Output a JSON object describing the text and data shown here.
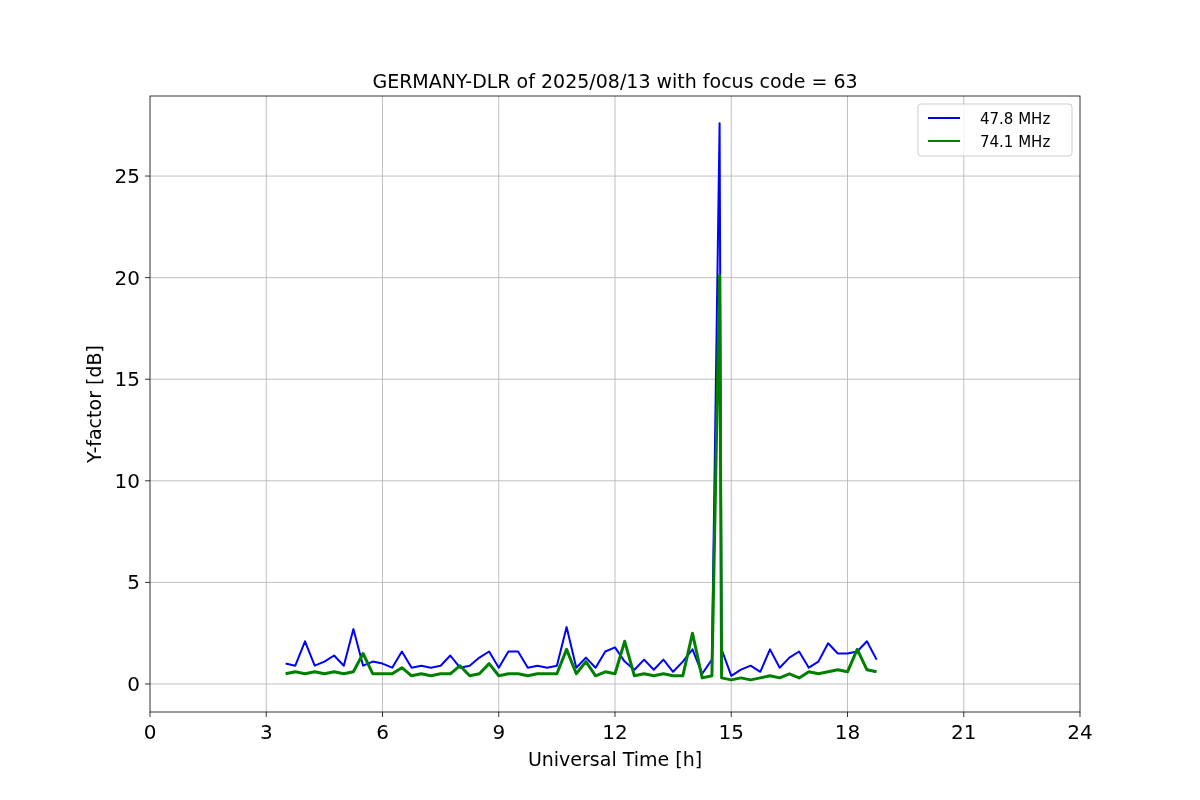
{
  "figure": {
    "chart_data": {
      "type": "line",
      "title": "GERMANY-DLR of 2025/08/13 with focus code = 63",
      "xlabel": "Universal Time [h]",
      "ylabel": "Y-factor [dB]",
      "x": [
        3.5,
        3.75,
        4,
        4.25,
        4.5,
        4.75,
        5,
        5.25,
        5.5,
        5.75,
        6,
        6.25,
        6.5,
        6.75,
        7,
        7.25,
        7.5,
        7.75,
        8,
        8.25,
        8.5,
        8.75,
        9,
        9.25,
        9.5,
        9.75,
        10,
        10.25,
        10.5,
        10.75,
        11,
        11.25,
        11.5,
        11.75,
        12,
        12.25,
        12.5,
        12.75,
        13,
        13.25,
        13.5,
        13.75,
        14,
        14.25,
        14.5,
        14.7,
        14.75,
        15,
        15.25,
        15.5,
        15.75,
        16,
        16.25,
        16.5,
        16.75,
        17,
        17.25,
        17.5,
        17.75,
        18,
        18.25,
        18.5,
        18.75
      ],
      "series": [
        {
          "name": "47.8 MHz",
          "color": "#0000ff",
          "values": [
            1.0,
            0.9,
            2.1,
            0.9,
            1.1,
            1.4,
            0.9,
            2.7,
            0.9,
            1.1,
            1.0,
            0.8,
            1.6,
            0.8,
            0.9,
            0.8,
            0.9,
            1.4,
            0.8,
            0.9,
            1.3,
            1.6,
            0.8,
            1.6,
            1.6,
            0.8,
            0.9,
            0.8,
            0.9,
            2.8,
            0.8,
            1.3,
            0.8,
            1.6,
            1.8,
            1.1,
            0.7,
            1.2,
            0.7,
            1.2,
            0.6,
            1.1,
            1.7,
            0.5,
            1.2,
            27.6,
            1.7,
            0.4,
            0.7,
            0.9,
            0.6,
            1.7,
            0.8,
            1.3,
            1.6,
            0.8,
            1.1,
            2.0,
            1.5,
            1.5,
            1.6,
            2.1,
            1.2
          ]
        },
        {
          "name": "74.1 MHz",
          "color": "#008000",
          "values": [
            0.5,
            0.6,
            0.5,
            0.6,
            0.5,
            0.6,
            0.5,
            0.6,
            1.5,
            0.5,
            0.5,
            0.5,
            0.8,
            0.4,
            0.5,
            0.4,
            0.5,
            0.5,
            0.9,
            0.4,
            0.5,
            1.0,
            0.4,
            0.5,
            0.5,
            0.4,
            0.5,
            0.5,
            0.5,
            1.7,
            0.5,
            1.1,
            0.4,
            0.6,
            0.5,
            2.1,
            0.4,
            0.5,
            0.4,
            0.5,
            0.4,
            0.4,
            2.5,
            0.3,
            0.4,
            20.1,
            0.3,
            0.2,
            0.3,
            0.2,
            0.3,
            0.4,
            0.3,
            0.5,
            0.3,
            0.6,
            0.5,
            0.6,
            0.7,
            0.6,
            1.7,
            0.7,
            0.6
          ]
        }
      ],
      "grid": true,
      "legend": true,
      "xlim": [
        0,
        24
      ],
      "ylim": [
        -1.38,
        28.94
      ],
      "xticks": [
        0,
        3,
        6,
        9,
        12,
        15,
        18,
        21,
        24
      ],
      "yticks": [
        0,
        5,
        10,
        15,
        20,
        25
      ]
    }
  }
}
